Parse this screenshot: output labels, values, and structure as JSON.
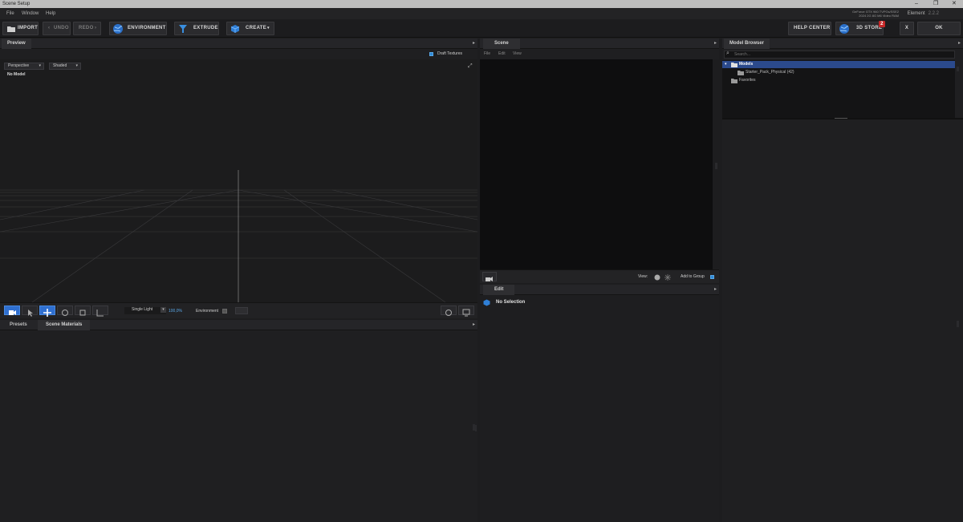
{
  "window": {
    "title": "Scene Setup",
    "controls": [
      "–",
      "❐",
      "✕"
    ]
  },
  "menu": {
    "items": [
      "File",
      "Window",
      "Help"
    ],
    "gpu_line1": "GeForce GTX 960 TVPGs/SSE2",
    "gpu_line2": "2024 2G 8G M6 Video RAM",
    "app_name": "Element",
    "app_version": "2.2.2"
  },
  "toolbar": {
    "import": "IMPORT",
    "undo": "UNDO",
    "redo": "REDO",
    "environment": "ENVIRONMENT",
    "extrude": "EXTRUDE",
    "create": "CREATE",
    "help_center": "HELP CENTER",
    "store": "3D STORE",
    "store_badge": "2",
    "close": "X",
    "ok": "OK"
  },
  "preview": {
    "tab": "Preview",
    "draft_textures": "Draft Textures",
    "camera_select": "Perspective",
    "shading_select": "Shaded",
    "no_model": "No Model",
    "light_select": "Single Light",
    "light_percent": "100,0%",
    "environment_label": "Environment"
  },
  "presets": {
    "tab_presets": "Presets",
    "tab_scene_materials": "Scene Materials"
  },
  "scene": {
    "tab": "Scene",
    "menu": [
      "File",
      "Edit",
      "View"
    ],
    "view_label": "View:",
    "add_to_group": "Add to Group"
  },
  "edit": {
    "tab": "Edit",
    "no_selection": "No Selection"
  },
  "model_browser": {
    "tab": "Model Browser",
    "search_placeholder": "Search...",
    "tree": {
      "models": "Models",
      "starter_pack": "Starter_Pack_Physical (42)",
      "favorites": "Favorites"
    }
  },
  "colors": {
    "accent": "#2f6fd0",
    "selection": "#2b4a8c",
    "badge": "#c62828"
  }
}
